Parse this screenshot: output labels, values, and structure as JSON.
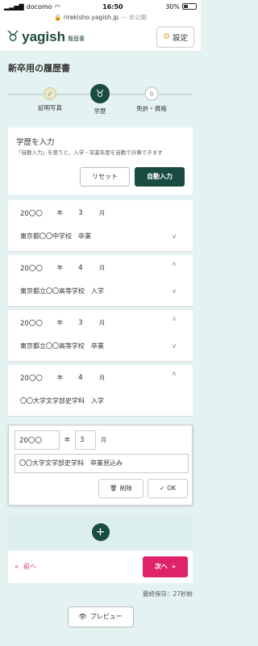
{
  "status_bar": {
    "carrier": "docomo",
    "time": "16:50",
    "battery": "30%"
  },
  "url_bar": {
    "domain": "rirekisho.yagish.jp",
    "privacy": "— 非公開"
  },
  "header": {
    "logo_text": "yagish",
    "logo_sub": "履歴書",
    "settings_label": "設定"
  },
  "page_title": "新卒用の履歴書",
  "progress": {
    "steps": [
      {
        "label": "証明写真",
        "state": "done"
      },
      {
        "label": "学歴",
        "state": "current"
      },
      {
        "number": "6",
        "label": "免許・資格",
        "state": "upcoming"
      }
    ]
  },
  "education_input": {
    "title": "学歴を入力",
    "hint": "「自動入力」を使うと、入学・卒業年度を自動で計算できます",
    "reset_label": "リセット",
    "auto_label": "自動入力"
  },
  "entries": [
    {
      "year": "20〇〇",
      "year_unit": "年",
      "month": "3",
      "month_unit": "月",
      "text": "東京都〇〇中学校　卒業"
    },
    {
      "year": "20〇〇",
      "year_unit": "年",
      "month": "4",
      "month_unit": "月",
      "text": "東京都立〇〇高等学校　入学"
    },
    {
      "year": "20〇〇",
      "year_unit": "年",
      "month": "3",
      "month_unit": "月",
      "text": "東京都立〇〇高等学校　卒業"
    },
    {
      "year": "20〇〇",
      "year_unit": "年",
      "month": "4",
      "month_unit": "月",
      "text": "〇〇大学文学部史学科　入学"
    }
  ],
  "editing_entry": {
    "year": "20〇〇",
    "year_unit": "年",
    "month": "3",
    "month_unit": "月",
    "text": "〇〇大学文学部史学科　卒業見込み",
    "delete_label": "削除",
    "ok_label": "OK"
  },
  "nav": {
    "prev_label": "前へ",
    "next_label": "次へ",
    "prev_icon": "«",
    "next_icon": "»"
  },
  "saved_status": "最終保存：27秒前",
  "preview_label": "プレビュー",
  "colors": {
    "brand_dark": "#1a4b40",
    "accent_pink": "#e02268",
    "background": "#e4f3f1"
  }
}
